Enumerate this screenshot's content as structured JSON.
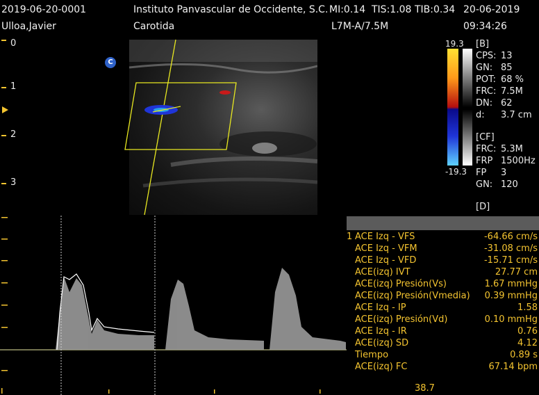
{
  "header": {
    "id": "2019-06-20-0001",
    "institution": "Instituto Panvascular de Occidente, S.C.",
    "mi": "MI:0.14",
    "tis": "TIS:1.08",
    "tib": "TIB:0.34",
    "date": "20-06-2019",
    "patient": "Ulloa,Javier",
    "exam": "Carotida",
    "probe": "L7M-A/7.5M",
    "time": "09:34:26"
  },
  "depth_scale": [
    "0",
    "1",
    "2",
    "3"
  ],
  "marker_c": "C",
  "color_scale": {
    "max": "19.3",
    "min": "-19.3"
  },
  "params": {
    "b_header": "[B]",
    "b": [
      {
        "k": "CPS:",
        "v": "13"
      },
      {
        "k": "GN:",
        "v": "85"
      },
      {
        "k": "POT:",
        "v": "68 %"
      },
      {
        "k": "FRC:",
        "v": "7.5M"
      },
      {
        "k": "DN:",
        "v": "62"
      },
      {
        "k": "d:",
        "v": "3.7 cm"
      }
    ],
    "cf_header": "[CF]",
    "cf": [
      {
        "k": "FRC:",
        "v": "5.3M"
      },
      {
        "k": "FRP",
        "v": "1500Hz"
      },
      {
        "k": "FP",
        "v": "3"
      },
      {
        "k": "GN:",
        "v": "120"
      }
    ],
    "d_header": "[D]"
  },
  "measurements": {
    "index": "1",
    "rows": [
      {
        "label": "ACE Izq - VFS",
        "value": "-64.66 cm/s"
      },
      {
        "label": "ACE Izq - VFM",
        "value": "-31.08 cm/s"
      },
      {
        "label": "ACE Izq - VFD",
        "value": "-15.71 cm/s"
      },
      {
        "label": "ACE(izq) IVT",
        "value": "27.77 cm"
      },
      {
        "label": "ACE(izq) Presión(Vs)",
        "value": "1.67 mmHg"
      },
      {
        "label": "ACE(izq) Presión(Vmedia)",
        "value": "0.39 mmHg"
      },
      {
        "label": "ACE Izq - IP",
        "value": "1.58"
      },
      {
        "label": "ACE(izq) Presión(Vd)",
        "value": "0.10 mmHg"
      },
      {
        "label": "ACE Izq - IR",
        "value": "0.76"
      },
      {
        "label": "ACE(izq) SD",
        "value": "4.12"
      },
      {
        "label": "Tiempo",
        "value": "0.89 s"
      },
      {
        "label": "ACE(izq) FC",
        "value": "67.14 bpm"
      }
    ]
  },
  "bottom_value": "38.7"
}
